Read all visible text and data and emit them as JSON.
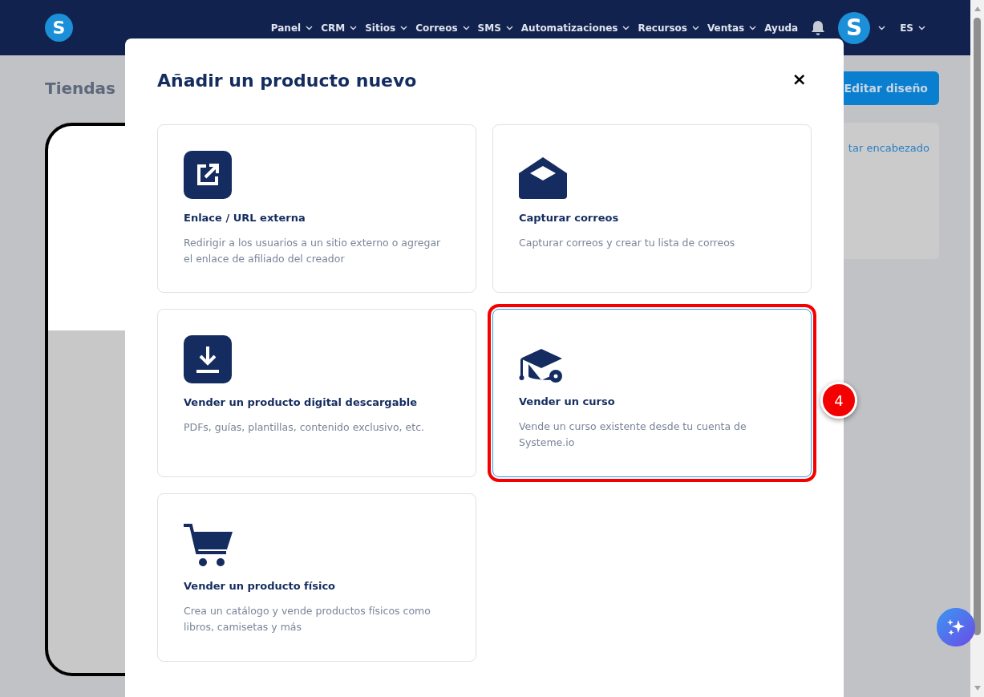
{
  "header": {
    "logo": "S",
    "nav": [
      {
        "label": "Panel",
        "has_menu": true
      },
      {
        "label": "CRM",
        "has_menu": true
      },
      {
        "label": "Sitios",
        "has_menu": true
      },
      {
        "label": "Correos",
        "has_menu": true
      },
      {
        "label": "SMS",
        "has_menu": true
      },
      {
        "label": "Automatizaciones",
        "has_menu": true
      },
      {
        "label": "Recursos",
        "has_menu": true
      },
      {
        "label": "Ventas",
        "has_menu": true
      },
      {
        "label": "Ayuda",
        "has_menu": false
      }
    ],
    "avatar": "S",
    "language": "ES"
  },
  "page": {
    "title": "Tiendas",
    "edit_button": "Editar diseño",
    "side_link": "tar encabezado"
  },
  "modal": {
    "title": "Añadir un producto nuevo",
    "close": "×",
    "options": [
      {
        "kind": "link",
        "title": "Enlace / URL externa",
        "description": "Redirigir a los usuarios a un sitio externo o agregar el enlace de afiliado del creador",
        "highlighted": false
      },
      {
        "kind": "email",
        "title": "Capturar correos",
        "description": "Capturar correos y crear tu lista de correos",
        "highlighted": false
      },
      {
        "kind": "download",
        "title": "Vender un producto digital descargable",
        "description": "PDFs, guías, plantillas, contenido exclusivo, etc.",
        "highlighted": false
      },
      {
        "kind": "course",
        "title": "Vender un curso",
        "description": "Vende un curso existente desde tu cuenta de Systeme.io",
        "highlighted": true,
        "step": "4"
      },
      {
        "kind": "physical",
        "title": "Vender un producto físico",
        "description": "Crea un catálogo y vende productos físicos como libros, camisetas y más",
        "highlighted": false
      }
    ]
  }
}
